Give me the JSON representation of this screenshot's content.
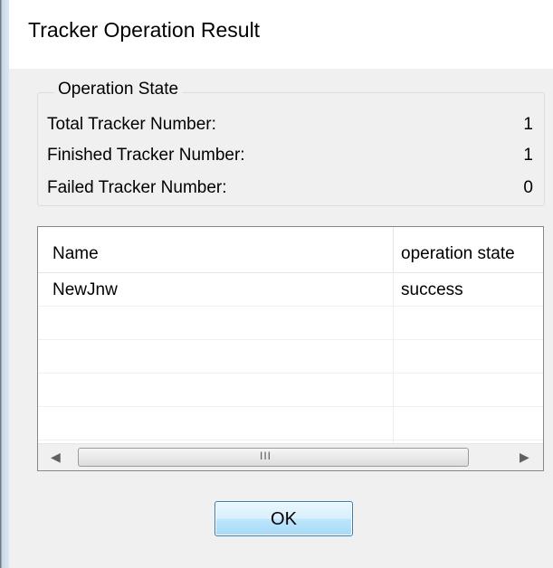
{
  "window": {
    "title": "Tracker Operation Result"
  },
  "operation_state": {
    "label": "Operation State",
    "items": [
      {
        "label": "Total Tracker Number:",
        "value": "1"
      },
      {
        "label": "Finished Tracker Number:",
        "value": "1"
      },
      {
        "label": "Failed Tracker Number:",
        "value": "0"
      }
    ]
  },
  "results_table": {
    "columns": [
      "Name",
      "operation state"
    ],
    "rows": [
      [
        "NewJnw",
        "success"
      ]
    ]
  },
  "scrollbar": {
    "left_arrow": "◀",
    "right_arrow": "▶",
    "grip": "III"
  },
  "buttons": {
    "ok_label": "OK"
  }
}
